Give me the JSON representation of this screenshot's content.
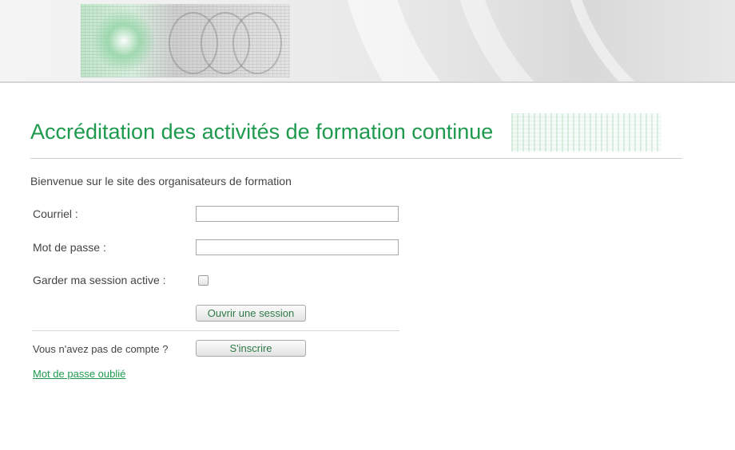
{
  "page": {
    "title": "Accréditation des activités de formation continue",
    "welcome": "Bienvenue sur le site des organisateurs de formation"
  },
  "login_form": {
    "email_label": "Courriel :",
    "email_value": "",
    "password_label": "Mot de passe :",
    "password_value": "",
    "remember_label": "Garder ma session active :",
    "remember_checked": false,
    "login_button": "Ouvrir une session"
  },
  "signup": {
    "prompt": "Vous n'avez pas de compte ?",
    "button": "S'inscrire"
  },
  "forgot_password": "Mot de passe oublié",
  "colors": {
    "accent": "#1e9a4e",
    "text": "#444444",
    "button_text": "#2d7a46"
  }
}
